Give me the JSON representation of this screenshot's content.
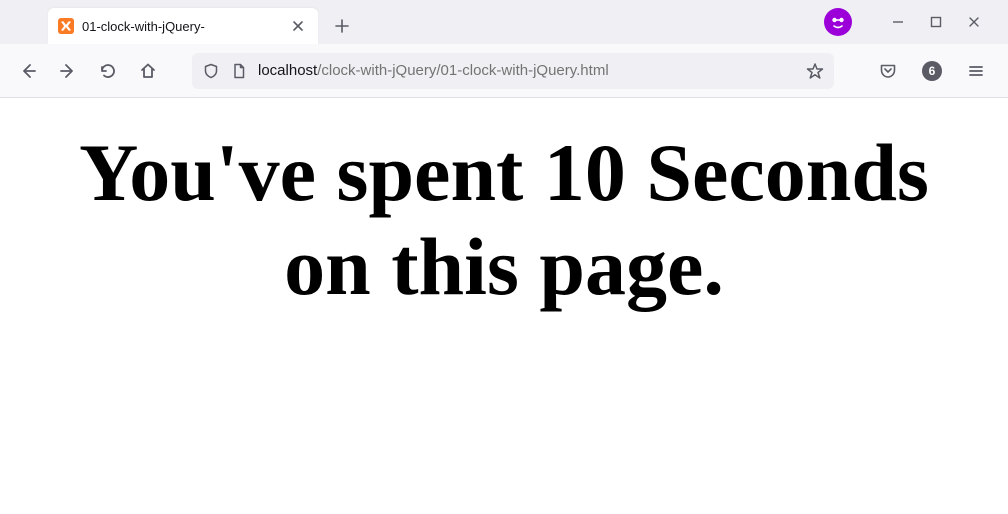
{
  "tab": {
    "title": "01-clock-with-jQuery-",
    "favicon": "xampp"
  },
  "url": {
    "host": "localhost",
    "path": "/clock-with-jQuery/01-clock-with-jQuery.html"
  },
  "toolbar": {
    "extension_count": "6"
  },
  "page": {
    "headline": "You've spent 10 Seconds on this page."
  }
}
